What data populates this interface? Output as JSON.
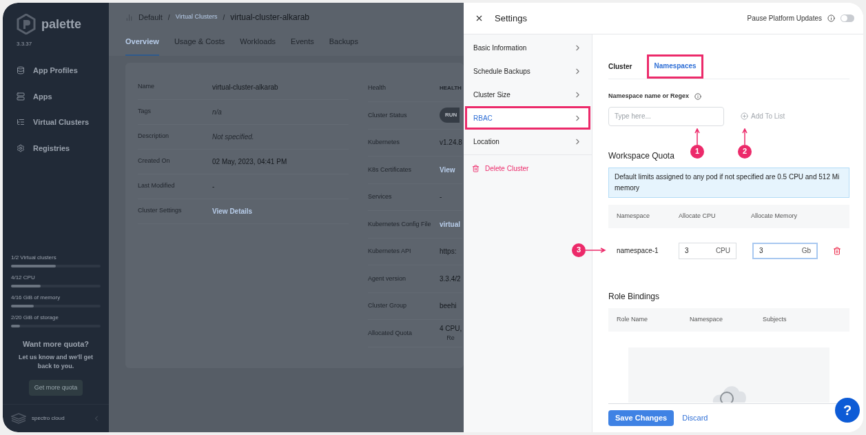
{
  "sidebar": {
    "brand": "palette",
    "version": "3.3.37",
    "items": [
      {
        "label": "App Profiles"
      },
      {
        "label": "Apps"
      },
      {
        "label": "Virtual Clusters"
      },
      {
        "label": "Registries"
      }
    ],
    "meters": [
      {
        "label": "1/2 Virtual clusters",
        "level": 0.5
      },
      {
        "label": "4/12 CPU",
        "level": 0.33
      },
      {
        "label": "4/16 GiB of memory",
        "level": 0.25
      },
      {
        "label": "2/20 GiB of storage",
        "level": 0.1
      }
    ],
    "promo": {
      "title": "Want more quota?",
      "text": "Let us know and we'll get back to you.",
      "button": "Get more quota"
    },
    "footer_brand": "spectro cloud"
  },
  "breadcrumb": {
    "project": "Default",
    "separator": "/",
    "section": "Virtual Clusters",
    "current": "virtual-cluster-alkarab"
  },
  "tabs": [
    {
      "label": "Overview",
      "selected": true
    },
    {
      "label": "Usage & Costs",
      "selected": false
    },
    {
      "label": "Workloads",
      "selected": false
    },
    {
      "label": "Events",
      "selected": false
    },
    {
      "label": "Backups",
      "selected": false
    }
  ],
  "details_left": [
    {
      "label": "Name",
      "value": "virtual-cluster-alkarab",
      "kind": "text"
    },
    {
      "label": "Tags",
      "value": "n/a",
      "kind": "muted"
    },
    {
      "label": "Description",
      "value": "Not specified.",
      "kind": "muted"
    },
    {
      "label": "Created On",
      "value": "02 May, 2023, 04:41 PM",
      "kind": "text"
    },
    {
      "label": "Last Modified",
      "value": "-",
      "kind": "text"
    },
    {
      "label": "Cluster Settings",
      "value": "View Details",
      "kind": "link"
    }
  ],
  "details_right": [
    {
      "label": "Health",
      "value": "HEALTH",
      "kind": "caps"
    },
    {
      "label": "Cluster Status",
      "value": "RUN",
      "kind": "pill"
    },
    {
      "label": "Kubernetes",
      "value": "v1.24.8",
      "kind": "text"
    },
    {
      "label": "K8s Certificates",
      "value": "View",
      "kind": "link"
    },
    {
      "label": "Services",
      "value": "-",
      "kind": "text"
    },
    {
      "label": "Kubernetes Config File",
      "value": "virtual",
      "kind": "link"
    },
    {
      "label": "Kubernetes API",
      "value": "https:",
      "kind": "text"
    },
    {
      "label": "Agent version",
      "value": "3.3.4/2",
      "kind": "text"
    },
    {
      "label": "Cluster Group",
      "value": "beehi",
      "kind": "text"
    },
    {
      "label": "Allocated Quota",
      "value": "4 CPU,",
      "extra": "Re",
      "kind": "text"
    }
  ],
  "drawer": {
    "title": "Settings",
    "pause_updates": {
      "label": "Pause Platform Updates",
      "on": false
    },
    "nav": [
      {
        "label": "Basic Information",
        "selected": false,
        "annotated": false
      },
      {
        "label": "Schedule Backups",
        "selected": false,
        "annotated": false
      },
      {
        "label": "Cluster Size",
        "selected": false,
        "annotated": false
      },
      {
        "label": "RBAC",
        "selected": true,
        "annotated": true
      },
      {
        "label": "Location",
        "selected": false,
        "annotated": false
      }
    ],
    "delete": "Delete Cluster",
    "tabs": [
      {
        "label": "Cluster",
        "selected": false,
        "annotated": false
      },
      {
        "label": "Namespaces",
        "selected": true,
        "annotated": true
      }
    ],
    "namespace_field": {
      "label": "Namespace name or Regex",
      "placeholder": "Type here..."
    },
    "add_button": {
      "label": "Add To List",
      "disabled": true
    },
    "markers": [
      "1",
      "2",
      "3"
    ],
    "quota_title": "Workspace Quota",
    "quota_note": "Default limits assigned to any pod if not specified are 0.5 CPU and 512 Mi memory",
    "quota_columns": [
      "Namespace",
      "Allocate CPU",
      "Allocate Memory"
    ],
    "quota_rows": [
      {
        "namespace": "namespace-1",
        "cpu": "3",
        "cpu_unit": "CPU",
        "memory": "3",
        "memory_unit": "Gb"
      }
    ],
    "roles_title": "Role Bindings",
    "roles_columns": [
      "Role Name",
      "Namespace",
      "Subjects"
    ],
    "save": "Save Changes",
    "discard": "Discard",
    "help": "?"
  }
}
